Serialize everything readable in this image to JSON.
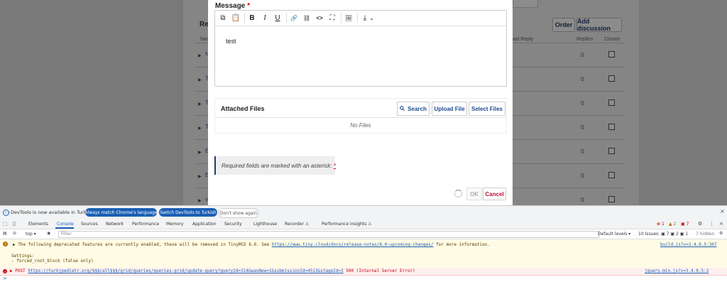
{
  "modal": {
    "message_label": "Message",
    "required_mark": "*",
    "editor_text": "test",
    "toolbar": {
      "copy": "⧉",
      "paste": "📋",
      "bold": "B",
      "italic": "I",
      "underline": "U",
      "link": "🔗",
      "unlink": "⛓",
      "code": "<>",
      "fullscreen": "⛶",
      "image": "🖼",
      "upload": "⤓",
      "dropdown": "⌄"
    },
    "attached_files": {
      "title": "Attached Files",
      "search_label": "Search",
      "upload_label": "Upload File",
      "select_label": "Select Files",
      "empty_text": "No Files"
    },
    "notice": "Required fields are marked with an asterisk:",
    "notice_star": "*",
    "ok_label": "OK",
    "cancel_label": "Cancel"
  },
  "background": {
    "title": "Rev",
    "order_label": "Order",
    "add_discussion_label": "Add discussion",
    "col_name": "Nam",
    "col_last_reply": "ast Reply",
    "col_replies": "Replies",
    "col_closed": "Closed",
    "rows": [
      {
        "marker": "N",
        "replies": "0"
      },
      {
        "marker": "T",
        "replies": "0"
      },
      {
        "marker": "T",
        "replies": "0"
      },
      {
        "marker": "T",
        "replies": "0"
      },
      {
        "marker": "E",
        "replies": "0"
      },
      {
        "marker": "E",
        "replies": "0"
      },
      {
        "marker": "v",
        "replies": "0"
      }
    ]
  },
  "devtools": {
    "infobar": {
      "text": "DevTools is now available in Turkish!",
      "match_language": "Always match Chrome's language",
      "switch_language": "Switch DevTools to Turkish",
      "dont_show": "Don't show again",
      "close": "×"
    },
    "tabs": [
      "Elements",
      "Console",
      "Sources",
      "Network",
      "Performance",
      "Memory",
      "Application",
      "Security",
      "Lighthouse",
      "Recorder ⚠",
      "Performance insights ⚠"
    ],
    "active_tab": "Console",
    "badges": {
      "errors": "1",
      "warnings": "2",
      "issues": "7"
    },
    "filter": {
      "context": "top ▾",
      "placeholder": "Filter",
      "levels": "Default levels ▾",
      "issues": "10 Issues: ▣ 7 ▣ 2 ▣ 1",
      "hidden": "7 hidden"
    },
    "warning": {
      "count": "2",
      "text_before": "▶ The following deprecated features are currently enabled, these will be removed in TinyMCE 6.0. See",
      "link": "https://www.tiny.cloud/docs/release-notes/6.0-upcoming-changes/",
      "text_after": "for more information.",
      "settings": "Settings:",
      "setting_item": "- forced_root_block (false only)",
      "source": "build.js?v=3.4.0.5:307"
    },
    "error": {
      "text_before": "▶ POST",
      "link": "https://turkjpediatr.org/$$$call$$$/grid/queries/queries-grid/update-query?queryId=314&wasNew=1&submissionId=4513&stageId=3",
      "text_after": "500 (Internal Server Error)",
      "source": "jquery.min.js?v=3.4.0.5:2"
    },
    "prompt": ">"
  },
  "colors": {
    "accent": "#1a5fb4",
    "brand_navy": "#1f3a6b",
    "cancel": "#c0103a",
    "required": "#dd0000"
  }
}
